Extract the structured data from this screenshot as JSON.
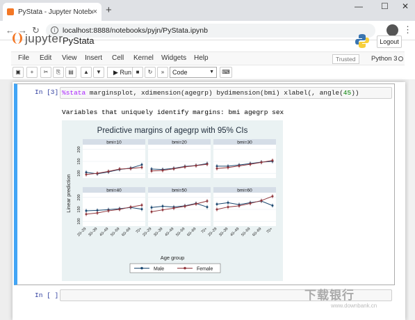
{
  "browser": {
    "tab_title": "PyStata - Jupyter Notebook",
    "tab_close": "×",
    "new_tab": "+",
    "url": "localhost:8888/notebooks/pyjn/PyStata.ipynb",
    "min": "—",
    "max": "☐",
    "close": "✕",
    "back": "←",
    "forward": "→",
    "reload": "↻",
    "menu": "⋮"
  },
  "jupyter": {
    "logo_text": "jupyter",
    "notebook_name": "PyStata",
    "logout_label": "Logout",
    "menu": [
      "File",
      "Edit",
      "View",
      "Insert",
      "Cell",
      "Kernel",
      "Widgets",
      "Help"
    ],
    "trusted": "Trusted",
    "kernel": "Python 3",
    "toolbar": {
      "run_label": "▶ Run",
      "cell_type": "Code"
    }
  },
  "cells": {
    "in3_prompt": "In [3]:",
    "in3_code_magic": "%stata",
    "in3_code_rest": " marginsplot, xdimension(agegrp) bydimension(bmi) xlabel(, angle(",
    "in3_code_num": "45",
    "in3_code_end": "))",
    "output_text": "Variables that uniquely identify margins: bmi agegrp sex",
    "empty_prompt": "In [ ]:"
  },
  "watermark": {
    "text": "下载银行",
    "sub": "www.downbank.cn"
  },
  "chart_data": {
    "type": "line",
    "title": "Predictive margins of agegrp with 95% CIs",
    "xlabel": "Age group",
    "ylabel": "Linear prediction",
    "categories": [
      "20–29",
      "30–39",
      "40–49",
      "50–59",
      "60–69",
      "70+"
    ],
    "yticks": [
      100,
      150,
      200
    ],
    "ylim": [
      80,
      220
    ],
    "grid": true,
    "legend_position": "bottom",
    "colors": {
      "Male": "#1a476f",
      "Female": "#90353b"
    },
    "panels": [
      {
        "label": "bmi=10",
        "series": [
          {
            "name": "Male",
            "values": [
              104,
              98,
              106,
              116,
              122,
              136
            ]
          },
          {
            "name": "Female",
            "values": [
              95,
              100,
              108,
              118,
              120,
              125
            ]
          }
        ]
      },
      {
        "label": "bmi=20",
        "series": [
          {
            "name": "Male",
            "values": [
              118,
              116,
              121,
              129,
              133,
              141
            ]
          },
          {
            "name": "Female",
            "values": [
              110,
              112,
              119,
              127,
              132,
              138
            ]
          }
        ]
      },
      {
        "label": "bmi=30",
        "series": [
          {
            "name": "Male",
            "values": [
              130,
              130,
              135,
              141,
              147,
              150
            ]
          },
          {
            "name": "Female",
            "values": [
              120,
              124,
              131,
              138,
              146,
              154
            ]
          }
        ]
      },
      {
        "label": "bmi=40",
        "series": [
          {
            "name": "Male",
            "values": [
              144,
              146,
              149,
              153,
              158,
              151
            ]
          },
          {
            "name": "Female",
            "values": [
              130,
              135,
              144,
              150,
              160,
              168
            ]
          }
        ]
      },
      {
        "label": "bmi=50",
        "series": [
          {
            "name": "Male",
            "values": [
              158,
              163,
              160,
              165,
              175,
              160
            ]
          },
          {
            "name": "Female",
            "values": [
              140,
              148,
              155,
              163,
              173,
              185
            ]
          }
        ]
      },
      {
        "label": "bmi=60",
        "series": [
          {
            "name": "Male",
            "values": [
              172,
              178,
              170,
              178,
              185,
              166
            ]
          },
          {
            "name": "Female",
            "values": [
              150,
              160,
              165,
              175,
              187,
              205
            ]
          }
        ]
      }
    ]
  }
}
